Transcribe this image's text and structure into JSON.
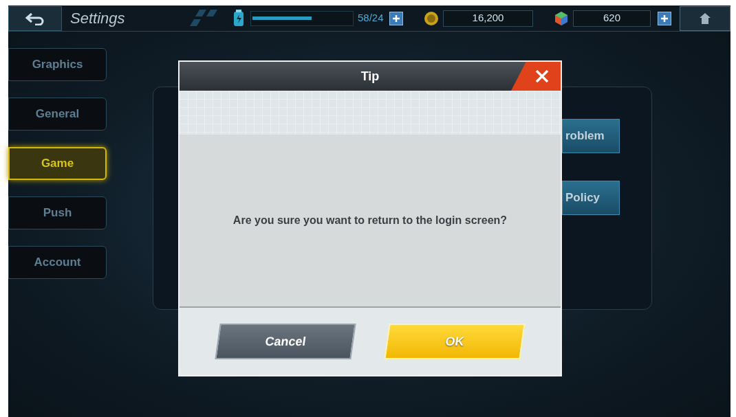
{
  "top_bar": {
    "title": "Settings",
    "energy": {
      "level": 0.6,
      "reading": "58/24"
    },
    "coins": "16,200",
    "gems": "620"
  },
  "sidebar": {
    "items": [
      {
        "label": "Graphics",
        "selected": false
      },
      {
        "label": "General",
        "selected": false
      },
      {
        "label": "Game",
        "selected": true
      },
      {
        "label": "Push",
        "selected": false
      },
      {
        "label": "Account",
        "selected": false
      }
    ]
  },
  "panel": {
    "buttons": [
      "roblem",
      "Policy"
    ]
  },
  "dialog": {
    "title": "Tip",
    "message": "Are you sure you want to return to the login screen?",
    "buttons": [
      {
        "label": "Cancel",
        "kind": "secondary"
      },
      {
        "label": "OK",
        "kind": "primary"
      }
    ]
  }
}
